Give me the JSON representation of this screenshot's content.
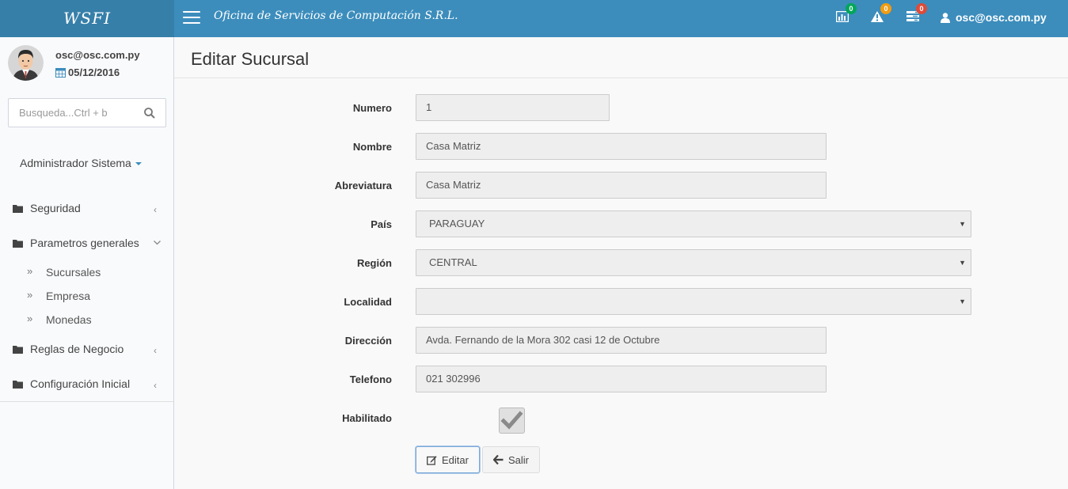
{
  "header": {
    "brand": "WSFI",
    "company": "Oficina de Servicios de Computación S.R.L.",
    "badges": {
      "charts": "0",
      "alerts": "0",
      "tasks": "0"
    },
    "user_email": "osc@osc.com.py"
  },
  "sidebar": {
    "user_name": "osc@osc.com.py",
    "user_date": "05/12/2016",
    "search_placeholder": "Busqueda...Ctrl + b",
    "role": "Administrador Sistema",
    "items": [
      {
        "label": "Seguridad"
      },
      {
        "label": "Parametros generales"
      },
      {
        "label": "Reglas de Negocio"
      },
      {
        "label": "Configuración Inicial"
      }
    ],
    "subitems": [
      {
        "label": "Sucursales"
      },
      {
        "label": "Empresa"
      },
      {
        "label": "Monedas"
      }
    ]
  },
  "page": {
    "title": "Editar Sucursal"
  },
  "form": {
    "numero": {
      "label": "Numero",
      "value": "1"
    },
    "nombre": {
      "label": "Nombre",
      "value": "Casa Matriz"
    },
    "abreviatura": {
      "label": "Abreviatura",
      "value": "Casa Matriz"
    },
    "pais": {
      "label": "País",
      "value": "PARAGUAY"
    },
    "region": {
      "label": "Región",
      "value": "CENTRAL"
    },
    "localidad": {
      "label": "Localidad",
      "value": ""
    },
    "direccion": {
      "label": "Dirección",
      "value": "Avda. Fernando de la Mora 302 casi 12 de Octubre"
    },
    "telefono": {
      "label": "Telefono",
      "value": "021 302996"
    },
    "habilitado": {
      "label": "Habilitado",
      "checked": true
    }
  },
  "buttons": {
    "edit": "Editar",
    "exit": "Salir"
  },
  "colors": {
    "header": "#3c8dbc",
    "brand_bg": "#367fa9",
    "badge_green": "#00a65a",
    "badge_yellow": "#f39c12",
    "badge_red": "#dd4b39"
  },
  "icons": [
    "menu-icon",
    "bar-chart-icon",
    "warning-icon",
    "tasks-icon",
    "user-icon",
    "calendar-icon",
    "search-icon",
    "folder-icon",
    "chevron-left-icon",
    "chevron-down-icon",
    "double-angle-right-icon",
    "edit-icon",
    "arrow-left-icon",
    "checkmark-icon"
  ]
}
